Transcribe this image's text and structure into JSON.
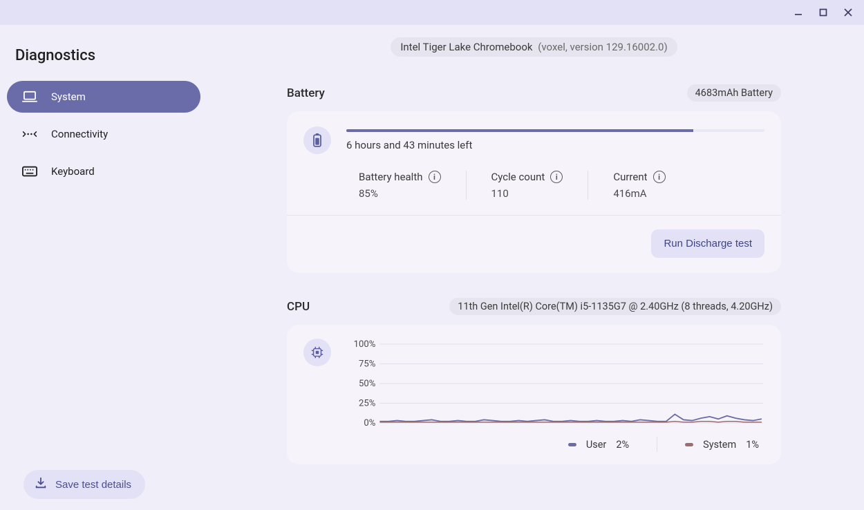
{
  "app_title": "Diagnostics",
  "window_controls": {
    "minimize": "minimize",
    "maximize": "maximize",
    "close": "close"
  },
  "sidebar": {
    "items": [
      {
        "label": "System",
        "icon": "laptop-icon",
        "active": true
      },
      {
        "label": "Connectivity",
        "icon": "connectivity-icon",
        "active": false
      },
      {
        "label": "Keyboard",
        "icon": "keyboard-icon",
        "active": false
      }
    ],
    "save_button": "Save test details"
  },
  "device": {
    "name": "Intel Tiger Lake Chromebook",
    "version": "(voxel, version 129.16002.0)"
  },
  "battery": {
    "section_title": "Battery",
    "chip": "4683mAh Battery",
    "progress_percent": 83,
    "time_left": "6 hours and 43 minutes left",
    "stats": {
      "health_label": "Battery health",
      "health_value": "85%",
      "cycle_label": "Cycle count",
      "cycle_value": "110",
      "current_label": "Current",
      "current_value": "416mA"
    },
    "run_button": "Run Discharge test"
  },
  "cpu": {
    "section_title": "CPU",
    "chip": "11th Gen Intel(R) Core(TM) i5-1135G7 @ 2.40GHz (8 threads, 4.20GHz)",
    "legend": {
      "user_label": "User",
      "user_value": "2%",
      "system_label": "System",
      "system_value": "1%"
    }
  },
  "chart_data": {
    "type": "line",
    "ylabel": "",
    "xlabel": "",
    "ylim": [
      0,
      100
    ],
    "y_ticks": [
      "100%",
      "75%",
      "50%",
      "25%",
      "0%"
    ],
    "series": [
      {
        "name": "User",
        "color": "#6a6ca9",
        "values": [
          2,
          2,
          3,
          2,
          2,
          3,
          4,
          2,
          2,
          3,
          2,
          2,
          4,
          3,
          2,
          2,
          3,
          2,
          3,
          4,
          2,
          2,
          3,
          2,
          2,
          3,
          2,
          2,
          3,
          2,
          4,
          3,
          2,
          2,
          11,
          4,
          3,
          6,
          8,
          5,
          9,
          6,
          4,
          3,
          5
        ]
      },
      {
        "name": "System",
        "color": "#9a6e6e",
        "values": [
          1,
          1,
          1,
          1,
          1,
          1,
          1,
          1,
          1,
          1,
          1,
          1,
          1,
          1,
          1,
          1,
          1,
          1,
          1,
          1,
          1,
          1,
          1,
          1,
          1,
          1,
          1,
          1,
          1,
          1,
          1,
          1,
          1,
          1,
          2,
          1,
          1,
          2,
          2,
          1,
          2,
          2,
          1,
          1,
          1
        ]
      }
    ]
  }
}
